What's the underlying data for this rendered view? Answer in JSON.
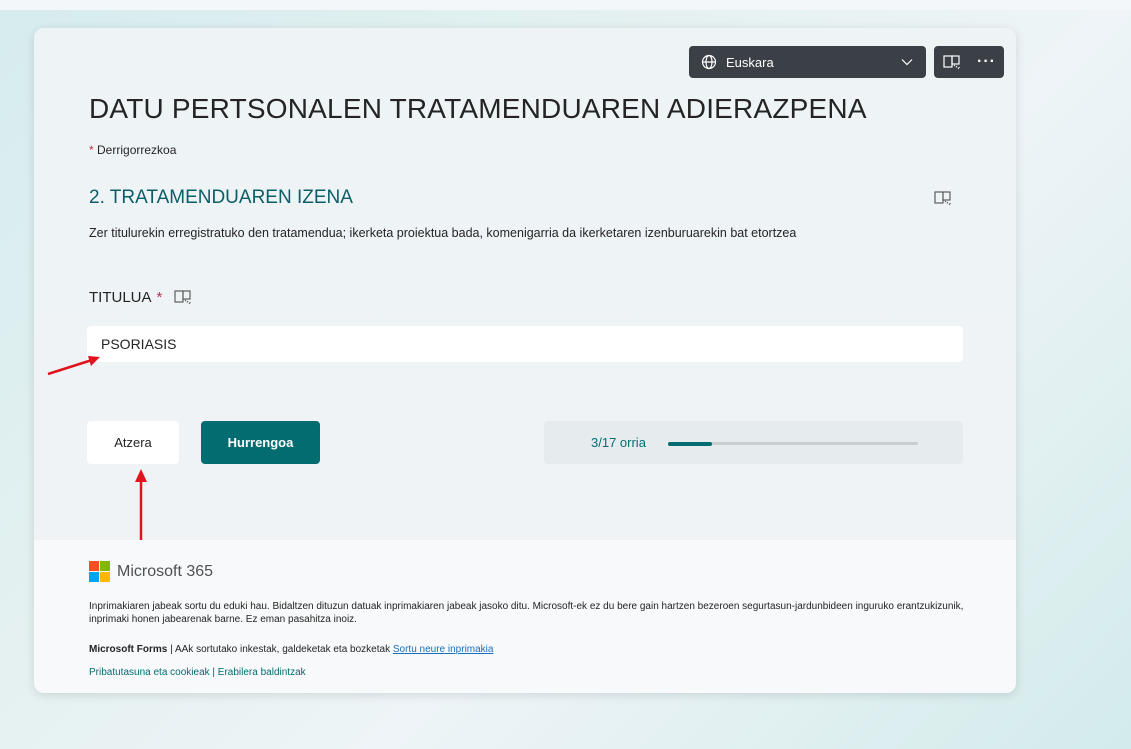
{
  "header": {
    "language": "Euskara",
    "more_glyph": "···",
    "icons": {
      "language": "globe-icon",
      "dropdown": "chevron-down-icon",
      "reader": "immersive-reader-icon",
      "more": "more-icon"
    }
  },
  "form": {
    "title": "DATU PERTSONALEN TRATAMENDUAREN ADIERAZPENA",
    "required_star": "*",
    "required_note": "Derrigorrezkoa",
    "section": {
      "title": "2. TRATAMENDUAREN IZENA",
      "description": "Zer titulurekin erregistratuko den tratamendua; ikerketa proiektua bada, komenigarria da ikerketaren izenburuarekin bat etortzea"
    },
    "question": {
      "label": "TITULUA",
      "star": "*",
      "answer": "PSORIASIS"
    }
  },
  "navigation": {
    "back_label": "Atzera",
    "next_label": "Hurrengoa",
    "page_indicator": "3/17 orria",
    "progress": 0.176
  },
  "footer": {
    "brand": "Microsoft 365",
    "disclaimer": "Inprimakiaren jabeak sortu du eduki hau. Bidaltzen dituzun datuak inprimakiaren jabeak jasoko ditu. Microsoft-ek ez du bere gain hartzen bezeroen segurtasun-jardunbideen inguruko erantzukizunik, inprimaki honen jabearenak barne. Ez eman pasahitza inoiz.",
    "forms_brand": "Microsoft Forms",
    "forms_separator": " | ",
    "forms_text": "AAk sortutako inkestak, galdeketak eta bozketak",
    "create_link": "Sortu neure inprimakia",
    "privacy_link": "Pribatutasuna eta cookieak",
    "links_separator": " | ",
    "terms_link": "Erabilera baldintzak"
  },
  "colors": {
    "accent": "#036c70",
    "required": "#c4314b",
    "annotation": "#e0141e",
    "ms_red": "#f25022",
    "ms_green": "#7fba00",
    "ms_blue": "#00a4ef",
    "ms_yellow": "#ffb900"
  }
}
